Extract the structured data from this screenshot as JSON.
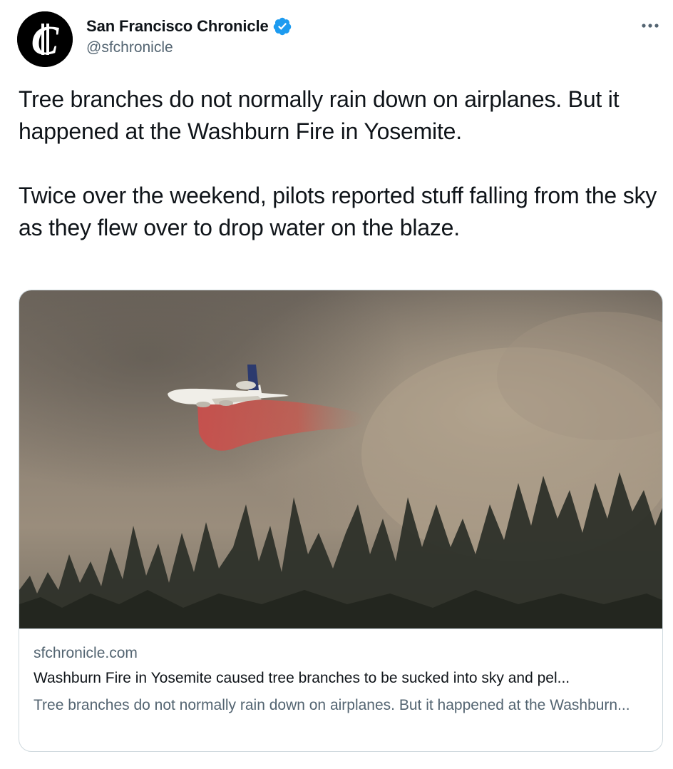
{
  "author": {
    "display_name": "San Francisco Chronicle",
    "handle": "@sfchronicle",
    "verified": true,
    "avatar_letter": "C"
  },
  "tweet": {
    "paragraphs": [
      "Tree branches do not normally rain down on airplanes. But it happened at the Washburn Fire in Yosemite.",
      "Twice over the weekend, pilots reported stuff falling from the sky as they flew over to drop water on the blaze."
    ]
  },
  "card": {
    "domain": "sfchronicle.com",
    "title": "Washburn Fire in Yosemite caused tree branches to be sucked into sky and pel...",
    "description": "Tree branches do not normally rain down on airplanes. But it happened at the Washburn...",
    "image_alt": "Air tanker dropping fire retardant over a smoky forest"
  },
  "colors": {
    "text_primary": "#0f1419",
    "text_secondary": "#536471",
    "verified_blue": "#1d9bf0",
    "border": "#cfd9de",
    "retardant": "#c94f4c",
    "smoke": "#8d8274"
  },
  "icons": {
    "verified": "verified-badge-icon",
    "more": "more-horizontal-icon"
  }
}
